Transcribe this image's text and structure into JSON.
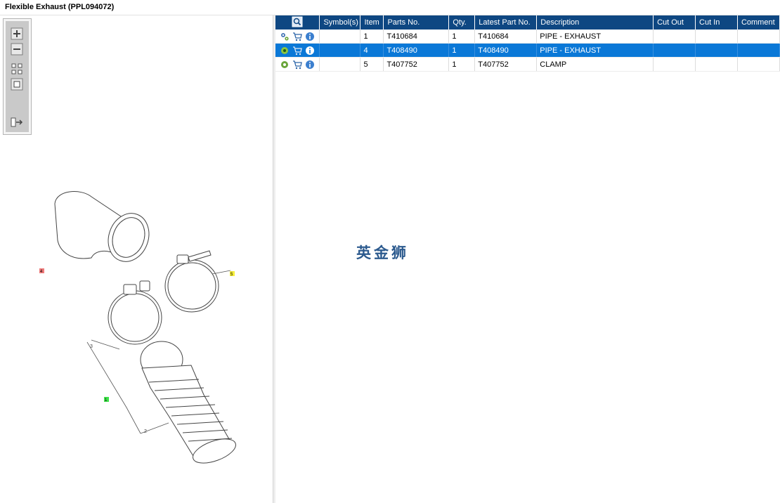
{
  "window": {
    "title": "Flexible Exhaust (PPL094072)"
  },
  "toolbar": {
    "buttons": [
      {
        "name": "zoom-in-icon"
      },
      {
        "name": "zoom-out-icon"
      },
      {
        "name": "fit-page-icon"
      },
      {
        "name": "actual-size-icon"
      },
      {
        "name": "toggle-list-icon"
      }
    ]
  },
  "diagram": {
    "callouts": [
      {
        "text": "4",
        "color": "#ef7a7a"
      },
      {
        "text": "5",
        "color": "#f7ef3b"
      },
      {
        "text": "1",
        "color": "#3fe34a"
      }
    ],
    "sub_labels": [
      "3",
      "2"
    ]
  },
  "table": {
    "columns": [
      "",
      "Symbol(s)",
      "Item",
      "Parts No.",
      "Qty.",
      "Latest Part No.",
      "Description",
      "Cut Out",
      "Cut In",
      "Comment"
    ],
    "header_icon": "search-parts-icon",
    "rows": [
      {
        "item": "1",
        "parts_no": "T410684",
        "qty": "1",
        "latest_part_no": "T410684",
        "description": "PIPE - EXHAUST",
        "cut_out": "",
        "cut_in": "",
        "comment": "",
        "selected": false
      },
      {
        "item": "4",
        "parts_no": "T408490",
        "qty": "1",
        "latest_part_no": "T408490",
        "description": "PIPE - EXHAUST",
        "cut_out": "",
        "cut_in": "",
        "comment": "",
        "selected": true
      },
      {
        "item": "5",
        "parts_no": "T407752",
        "qty": "1",
        "latest_part_no": "T407752",
        "description": "CLAMP",
        "cut_out": "",
        "cut_in": "",
        "comment": "",
        "selected": false
      }
    ],
    "row_icons": [
      "gear-icon",
      "cart-icon",
      "info-icon"
    ]
  },
  "watermark": "英金狮",
  "colors": {
    "header_bg": "#0e4782",
    "selection": "#0a78d7"
  }
}
